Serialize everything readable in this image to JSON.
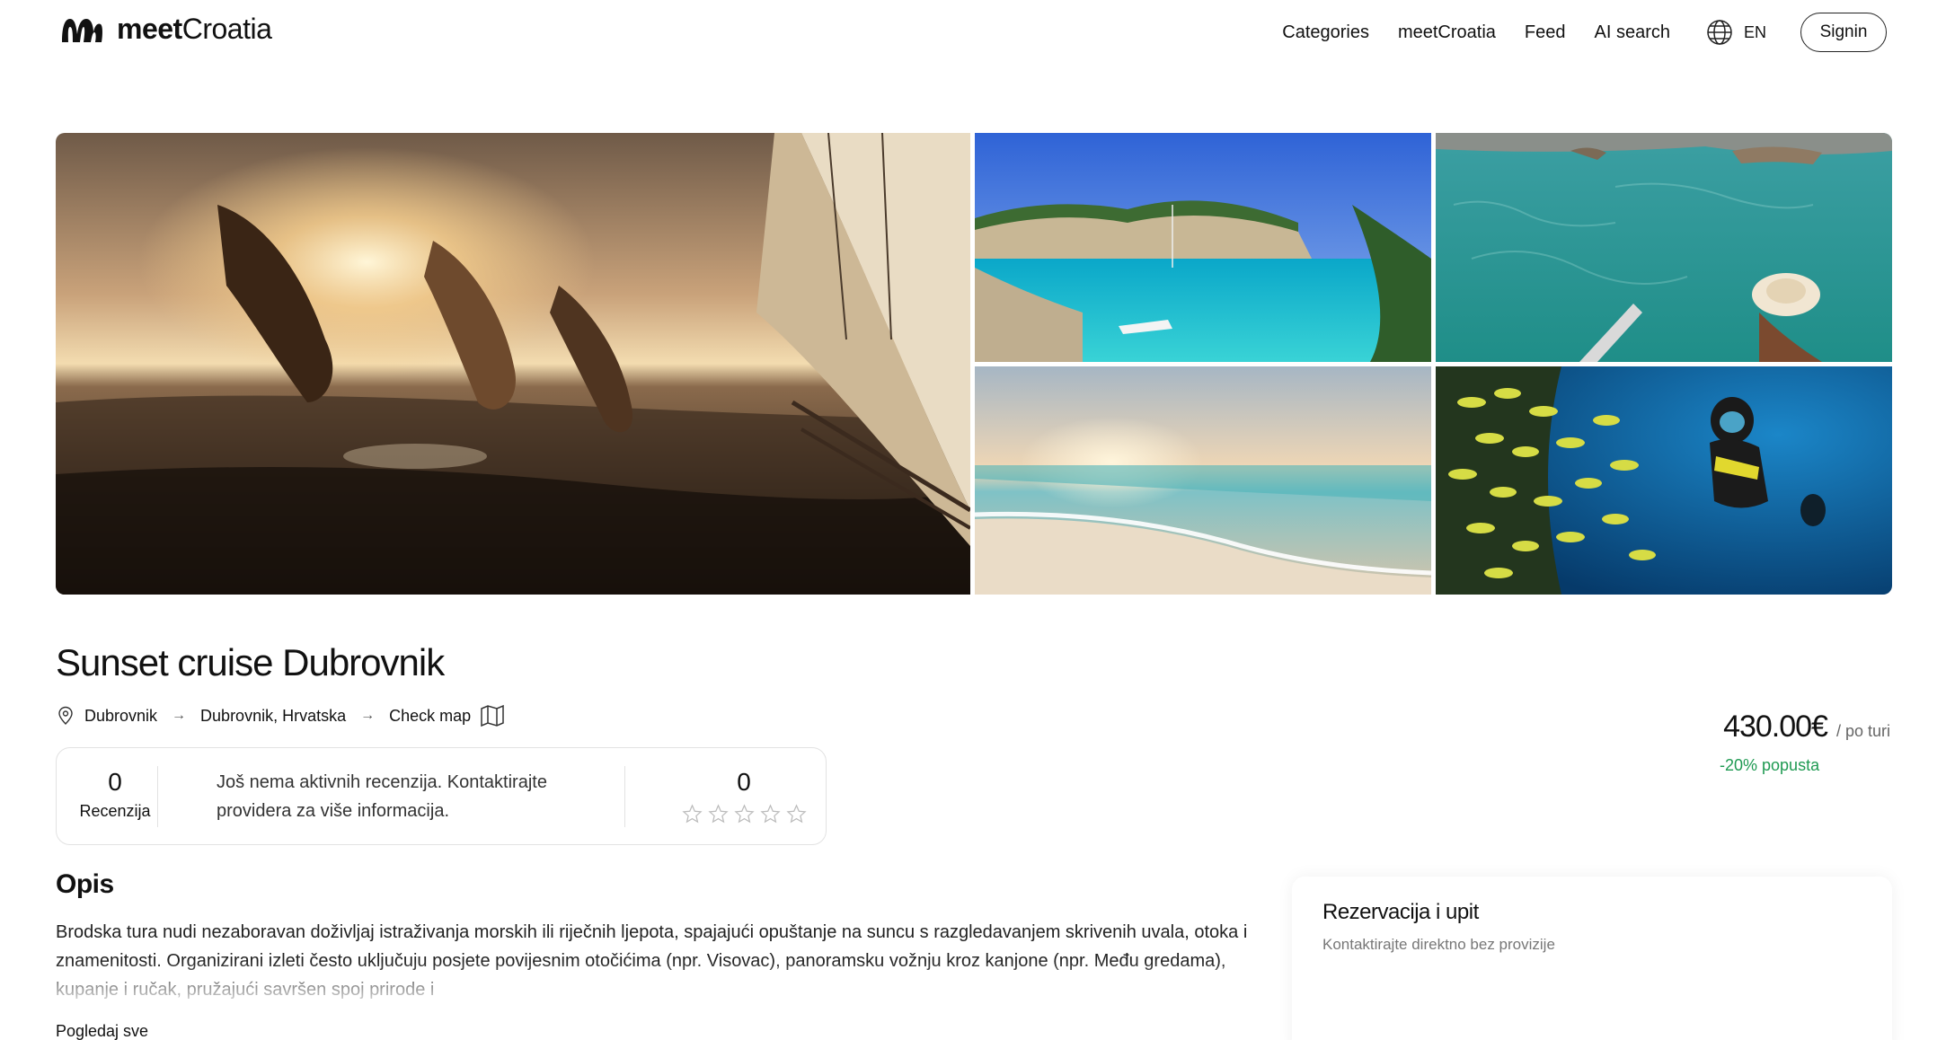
{
  "header": {
    "logo_bold": "meet",
    "logo_light": "Croatia",
    "nav": [
      "Categories",
      "meetCroatia",
      "Feed",
      "AI search"
    ],
    "language": "EN",
    "signin_label": "Signin"
  },
  "gallery": {
    "images": [
      "friends-jumping-from-sailboat-sunset",
      "turquoise-cove-with-boat",
      "woman-with-hat-clear-sea",
      "beach-sunset-waves",
      "diver-with-fish-school"
    ]
  },
  "listing": {
    "title": "Sunset cruise Dubrovnik",
    "breadcrumb": [
      "Dubrovnik",
      "Dubrovnik, Hrvatska",
      "Check map"
    ]
  },
  "reviews": {
    "count": "0",
    "count_label": "Recenzija",
    "message": "Još nema aktivnih recenzija. Kontaktirajte providera za više informacija.",
    "rating": "0",
    "stars": 0
  },
  "price": {
    "value": "430.00€",
    "unit": "/ po turi",
    "discount": "-20% popusta"
  },
  "description": {
    "title": "Opis",
    "text": "Brodska tura nudi nezaboravan doživljaj istraživanja morskih ili riječnih ljepota, spajajući opuštanje na suncu s razgledavanjem skrivenih uvala, otoka i znamenitosti. Organizirani izleti često uključuju posjete povijesnim otočićima (npr. Visovac), panoramsku vožnju kroz kanjone (npr. Među gredama), kupanje i ručak, pružajući savršen spoj prirode i",
    "see_all": "Pogledaj sve"
  },
  "reservation": {
    "title": "Rezervacija i upit",
    "subtitle": "Kontaktirajte direktno bez provizije"
  },
  "colors": {
    "accent_green": "#1f9a52",
    "border": "#e2e2e2"
  }
}
